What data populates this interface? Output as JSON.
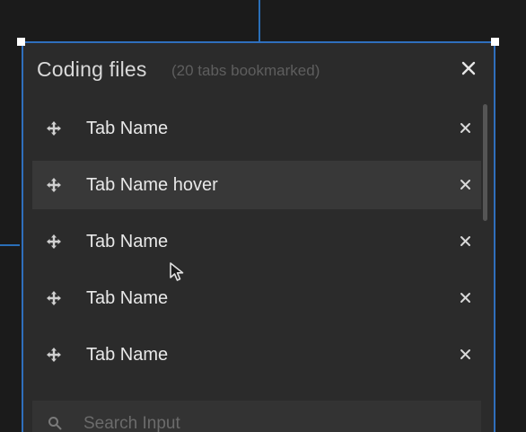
{
  "panel": {
    "title": "Coding files",
    "subtitle": "(20 tabs bookmarked)",
    "close_icon": "close-icon"
  },
  "tabs": [
    {
      "label": "Tab Name",
      "state": "default"
    },
    {
      "label": "Tab Name hover",
      "state": "hover"
    },
    {
      "label": "Tab Name",
      "state": "default"
    },
    {
      "label": "Tab Name",
      "state": "default"
    },
    {
      "label": "Tab Name",
      "state": "default"
    }
  ],
  "row_icons": {
    "drag": "drag-handle-icon",
    "remove": "close-icon"
  },
  "search": {
    "placeholder": "Search Input",
    "value": "",
    "icon": "search-icon"
  },
  "colors": {
    "background": "#1b1b1b",
    "panel": "#2b2b2b",
    "selection_border": "#2f6fbd",
    "hover_row": "#383838",
    "text": "#e8e8e8",
    "muted_text": "#5e5e5e"
  }
}
